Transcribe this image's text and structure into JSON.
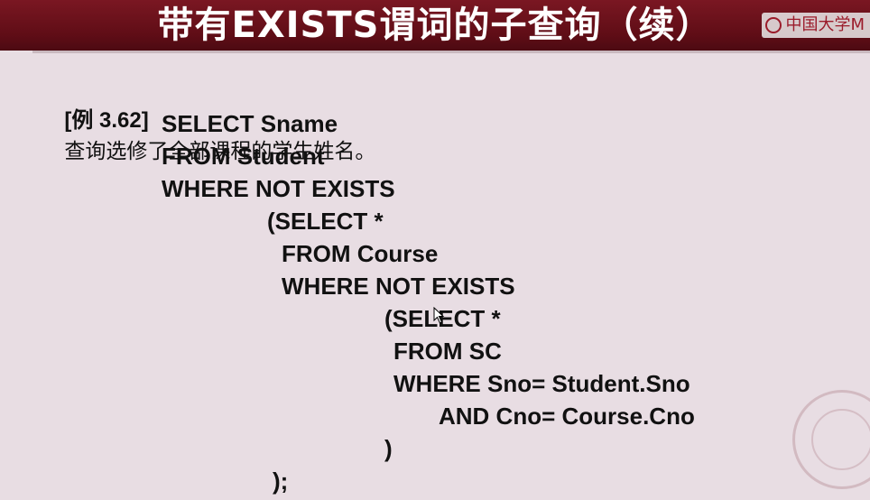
{
  "slide": {
    "title": "带有EXISTS谓词的子查询（续）",
    "watermark": "中国大学M",
    "example_label": "[例 3.62]",
    "example_desc": "查询选修了全部课程的学生姓名。"
  },
  "code": [
    "SELECT Sname",
    "FROM Student",
    "WHERE NOT EXISTS",
    "(SELECT *",
    "FROM Course",
    "WHERE NOT EXISTS",
    "(SELECT *",
    "FROM SC",
    "WHERE Sno= Student.Sno",
    "AND Cno= Course.Cno",
    ")",
    ");"
  ],
  "colors": {
    "title_bar": "#6b111b",
    "background": "#e8dde3",
    "text": "#111111"
  },
  "icons": {
    "watermark_logo": "mooc-logo-icon",
    "seal": "university-seal-icon",
    "cursor": "mouse-pointer-icon"
  }
}
